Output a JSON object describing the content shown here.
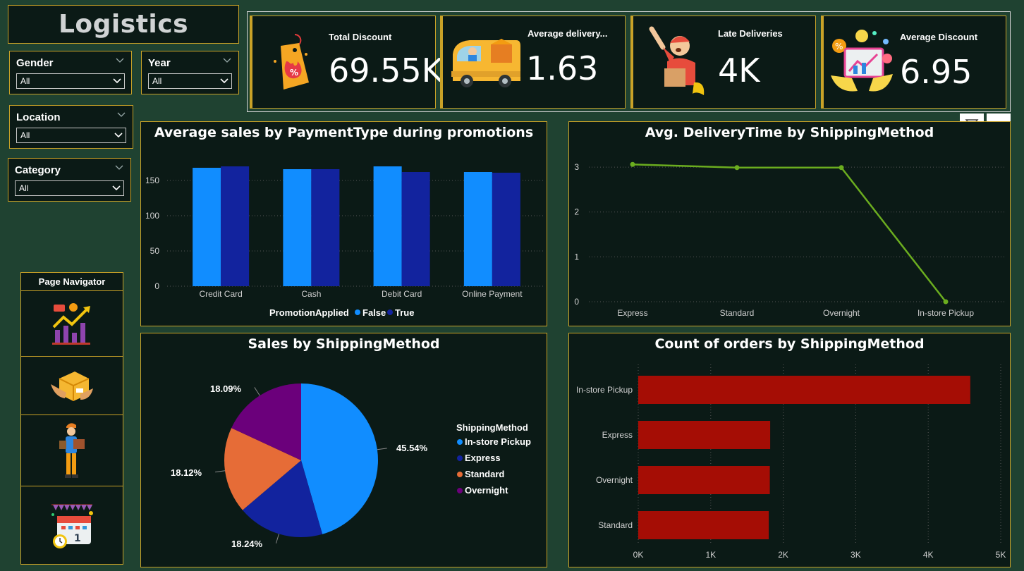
{
  "app": {
    "title": "Logistics"
  },
  "filters": {
    "gender": {
      "label": "Gender",
      "value": "All"
    },
    "year": {
      "label": "Year",
      "value": "All"
    },
    "location": {
      "label": "Location",
      "value": "All"
    },
    "category": {
      "label": "Category",
      "value": "All"
    }
  },
  "kpis": [
    {
      "label": "Total Discount",
      "value": "69.55K",
      "icon": "discount-tag-icon"
    },
    {
      "label": "Average delivery...",
      "value": "1.63",
      "icon": "delivery-van-icon"
    },
    {
      "label": "Late Deliveries",
      "value": "4K",
      "icon": "courier-icon"
    },
    {
      "label": "Average Discount",
      "value": "6.95",
      "icon": "promo-analytics-icon"
    }
  ],
  "visual_header": {
    "filter_icon": "filter-icon",
    "more_icon": "more-options-icon",
    "more_label": "···"
  },
  "navigator": {
    "title": "Page Navigator",
    "items": [
      {
        "icon": "growth-chart-icon"
      },
      {
        "icon": "package-hands-icon"
      },
      {
        "icon": "delivery-man-icon"
      },
      {
        "icon": "calendar-celebration-icon"
      }
    ]
  },
  "colors": {
    "false": "#118dff",
    "true": "#12239e",
    "line": "#6bad1f",
    "bar": "#a50d05",
    "instore": "#118dff",
    "express": "#12239e",
    "standard": "#e66c37",
    "overnight": "#6b007b",
    "border": "#c9a227"
  },
  "chart_data": [
    {
      "type": "bar",
      "title": "Average sales by PaymentType during promotions",
      "categories": [
        "Credit Card",
        "Cash",
        "Debit Card",
        "Online Payment"
      ],
      "legend_title": "PromotionApplied",
      "series": [
        {
          "name": "False",
          "values": [
            168,
            166,
            170,
            162
          ]
        },
        {
          "name": "True",
          "values": [
            170,
            166,
            162,
            161
          ]
        }
      ],
      "yticks": [
        0,
        50,
        100,
        150
      ],
      "ylim": [
        0,
        180
      ],
      "grid": true,
      "legend_position": "bottom"
    },
    {
      "type": "line",
      "title": "Avg. DeliveryTime by ShippingMethod",
      "categories": [
        "Express",
        "Standard",
        "Overnight",
        "In-store Pickup"
      ],
      "values": [
        3.06,
        2.99,
        2.99,
        0.0
      ],
      "yticks": [
        0,
        1,
        2,
        3
      ],
      "ylim": [
        0,
        3.3
      ],
      "grid": true
    },
    {
      "type": "pie",
      "title": "Sales by ShippingMethod",
      "legend_title": "ShippingMethod",
      "slices": [
        {
          "name": "In-store Pickup",
          "value": 45.54,
          "label": "45.54%"
        },
        {
          "name": "Express",
          "value": 18.24,
          "label": "18.24%"
        },
        {
          "name": "Standard",
          "value": 18.12,
          "label": "18.12%"
        },
        {
          "name": "Overnight",
          "value": 18.09,
          "label": "18.09%"
        }
      ],
      "legend_position": "right"
    },
    {
      "type": "bar",
      "orientation": "horizontal",
      "title": "Count of orders by ShippingMethod",
      "categories": [
        "In-store Pickup",
        "Express",
        "Overnight",
        "Standard"
      ],
      "values": [
        4580,
        1820,
        1815,
        1800
      ],
      "xticks": [
        "0K",
        "1K",
        "2K",
        "3K",
        "4K",
        "5K"
      ],
      "xlim": [
        0,
        5000
      ],
      "grid": true
    }
  ]
}
